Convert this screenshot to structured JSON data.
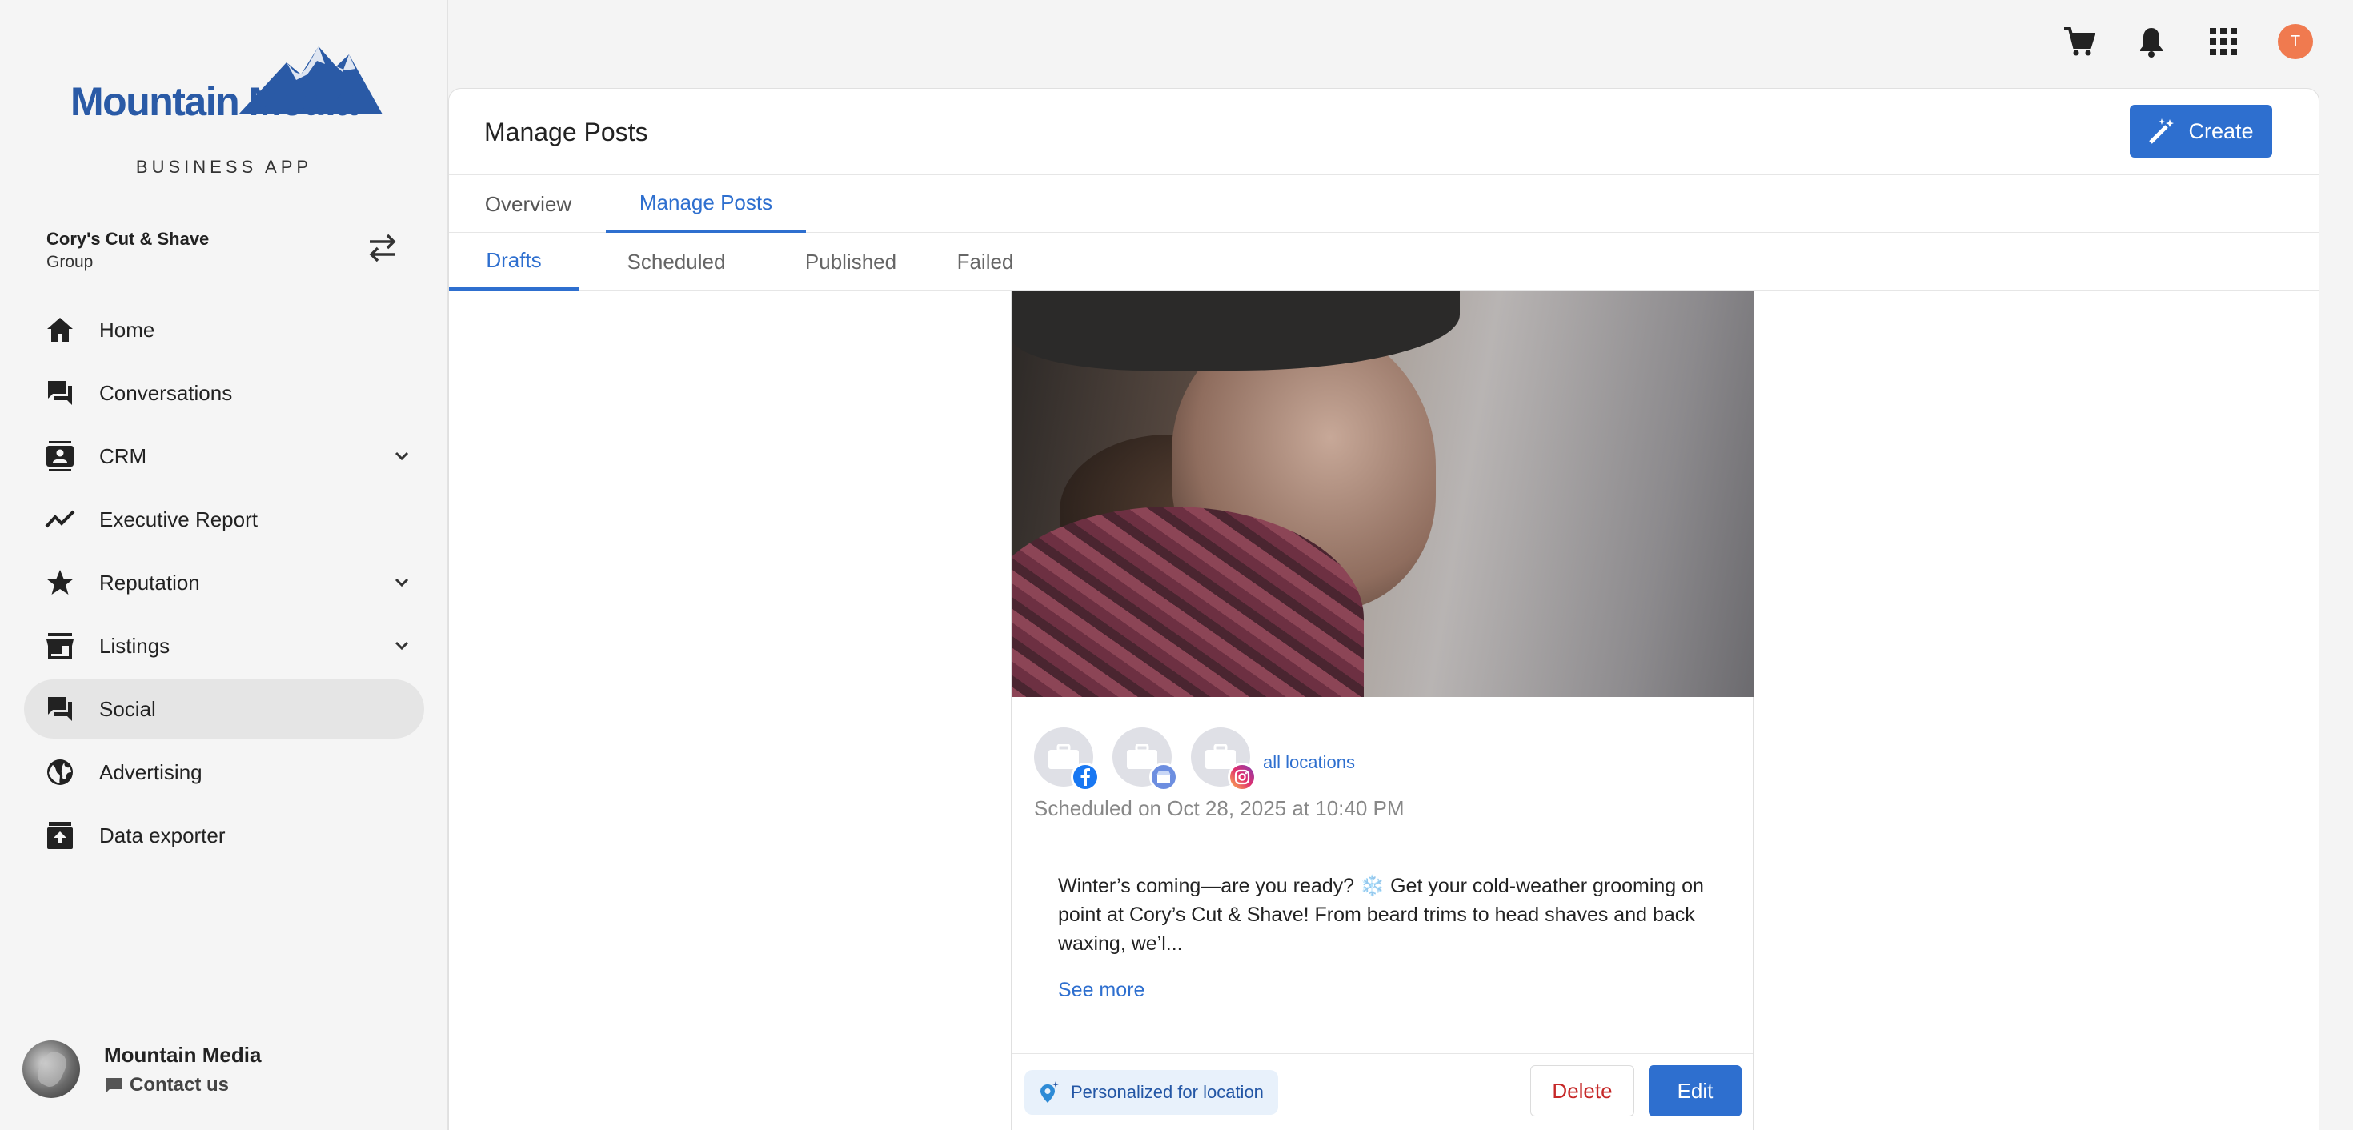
{
  "brand": {
    "logo_text": "Mountain Media",
    "subtitle": "BUSINESS APP"
  },
  "account": {
    "name": "Cory's Cut & Shave",
    "type": "Group"
  },
  "sidebar": {
    "items": [
      {
        "label": "Home",
        "icon": "home-icon"
      },
      {
        "label": "Conversations",
        "icon": "chat-icon"
      },
      {
        "label": "CRM",
        "icon": "contact-card-icon",
        "expandable": true
      },
      {
        "label": "Executive Report",
        "icon": "trend-line-icon"
      },
      {
        "label": "Reputation",
        "icon": "star-icon",
        "expandable": true
      },
      {
        "label": "Listings",
        "icon": "storefront-icon",
        "expandable": true
      },
      {
        "label": "Social",
        "icon": "chat-icon",
        "active": true
      },
      {
        "label": "Advertising",
        "icon": "globe-icon"
      },
      {
        "label": "Data exporter",
        "icon": "archive-icon"
      }
    ]
  },
  "footer": {
    "name": "Mountain Media",
    "contact_label": "Contact us"
  },
  "topbar": {
    "user_initial": "T"
  },
  "main": {
    "title": "Manage Posts",
    "create_label": "Create",
    "tabs": [
      {
        "label": "Overview"
      },
      {
        "label": "Manage Posts",
        "active": true
      }
    ],
    "subtabs": [
      {
        "label": "Drafts",
        "active": true
      },
      {
        "label": "Scheduled"
      },
      {
        "label": "Published"
      },
      {
        "label": "Failed"
      }
    ]
  },
  "post": {
    "all_locations_label": "all locations",
    "scheduled": "Scheduled on Oct 28, 2025 at 10:40 PM",
    "text": "Winter’s coming—are you ready? ❄️ Get your cold-weather grooming on point at Cory’s Cut & Shave! From beard trims to head shaves and back waxing, we’l...",
    "see_more": "See more",
    "personalized_label": "Personalized for location",
    "delete_label": "Delete",
    "edit_label": "Edit"
  },
  "colors": {
    "accent": "#2e6fcf",
    "danger": "#c62828",
    "brand": "#2a5aa6",
    "avatar": "#f07a4f"
  }
}
